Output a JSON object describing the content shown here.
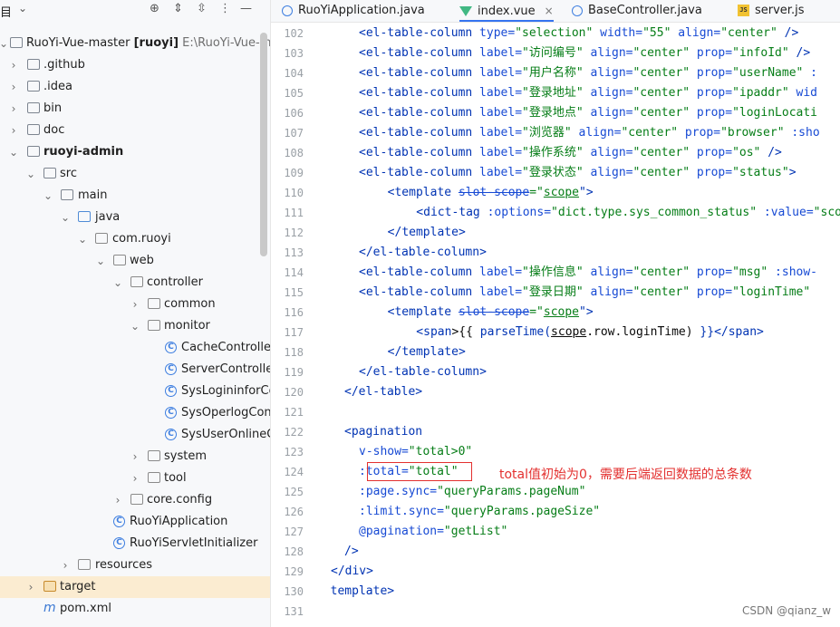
{
  "project_panel": {
    "title": "目",
    "tree": [
      {
        "label": "RuoYi-Vue-master",
        "bold_suffix": "[ruoyi]",
        "path": "E:\\RuoYi-Vue-m",
        "icon": "module-folder-icon"
      },
      {
        "label": ".github",
        "icon": "folder-icon"
      },
      {
        "label": ".idea",
        "icon": "folder-icon"
      },
      {
        "label": "bin",
        "icon": "folder-icon"
      },
      {
        "label": "doc",
        "icon": "folder-icon"
      },
      {
        "label": "ruoyi-admin",
        "icon": "module-folder-icon"
      },
      {
        "label": "src",
        "icon": "folder-icon"
      },
      {
        "label": "main",
        "icon": "folder-icon"
      },
      {
        "label": "java",
        "icon": "source-folder-icon"
      },
      {
        "label": "com.ruoyi",
        "icon": "package-icon"
      },
      {
        "label": "web",
        "icon": "package-icon"
      },
      {
        "label": "controller",
        "icon": "package-icon"
      },
      {
        "label": "common",
        "icon": "package-icon"
      },
      {
        "label": "monitor",
        "icon": "package-icon"
      },
      {
        "label": "CacheControlle",
        "icon": "class-icon"
      },
      {
        "label": "ServerControlle",
        "icon": "class-icon"
      },
      {
        "label": "SysLogininforCo",
        "icon": "class-icon"
      },
      {
        "label": "SysOperlogCon",
        "icon": "class-icon"
      },
      {
        "label": "SysUserOnlineC",
        "icon": "class-icon"
      },
      {
        "label": "system",
        "icon": "package-icon"
      },
      {
        "label": "tool",
        "icon": "package-icon"
      },
      {
        "label": "core.config",
        "icon": "package-icon"
      },
      {
        "label": "RuoYiApplication",
        "icon": "spring-class-icon"
      },
      {
        "label": "RuoYiServletInitializer",
        "icon": "class-icon"
      },
      {
        "label": "resources",
        "icon": "resources-folder-icon"
      },
      {
        "label": "target",
        "icon": "excluded-folder-icon"
      },
      {
        "label": "pom.xml",
        "icon": "maven-icon"
      }
    ]
  },
  "tabs": [
    {
      "label": "RuoYiApplication.java",
      "icon": "java-class-icon"
    },
    {
      "label": "index.vue",
      "icon": "vue-icon",
      "close": "×"
    },
    {
      "label": "BaseController.java",
      "icon": "java-class-icon"
    },
    {
      "label": "server.js",
      "icon": "js-icon",
      "icon_text": "JS"
    }
  ],
  "editor": {
    "line_numbers": [
      "102",
      "103",
      "104",
      "105",
      "106",
      "107",
      "108",
      "109",
      "110",
      "111",
      "112",
      "113",
      "114",
      "115",
      "116",
      "117",
      "118",
      "119",
      "120",
      "121",
      "122",
      "123",
      "124",
      "125",
      "126",
      "127",
      "128",
      "129",
      "130",
      "131"
    ],
    "lines": [
      [
        [
          "  <",
          "tag"
        ],
        [
          "el-table-column",
          "tag"
        ],
        [
          " type=",
          "attr"
        ],
        [
          "\"selection\"",
          "str"
        ],
        [
          " width=",
          "attr"
        ],
        [
          "\"55\"",
          "str"
        ],
        [
          " align=",
          "attr"
        ],
        [
          "\"center\"",
          "str"
        ],
        [
          " />",
          "tag"
        ]
      ],
      [
        [
          "  <",
          "tag"
        ],
        [
          "el-table-column",
          "tag"
        ],
        [
          " label=",
          "attr"
        ],
        [
          "\"访问编号\"",
          "str"
        ],
        [
          " align=",
          "attr"
        ],
        [
          "\"center\"",
          "str"
        ],
        [
          " prop=",
          "attr"
        ],
        [
          "\"infoId\"",
          "str"
        ],
        [
          " />",
          "tag"
        ]
      ],
      [
        [
          "  <",
          "tag"
        ],
        [
          "el-table-column",
          "tag"
        ],
        [
          " label=",
          "attr"
        ],
        [
          "\"用户名称\"",
          "str"
        ],
        [
          " align=",
          "attr"
        ],
        [
          "\"center\"",
          "str"
        ],
        [
          " prop=",
          "attr"
        ],
        [
          "\"userName\"",
          "str"
        ],
        [
          " :",
          "attr"
        ]
      ],
      [
        [
          "  <",
          "tag"
        ],
        [
          "el-table-column",
          "tag"
        ],
        [
          " label=",
          "attr"
        ],
        [
          "\"登录地址\"",
          "str"
        ],
        [
          " align=",
          "attr"
        ],
        [
          "\"center\"",
          "str"
        ],
        [
          " prop=",
          "attr"
        ],
        [
          "\"ipaddr\"",
          "str"
        ],
        [
          " wid",
          "attr"
        ]
      ],
      [
        [
          "  <",
          "tag"
        ],
        [
          "el-table-column",
          "tag"
        ],
        [
          " label=",
          "attr"
        ],
        [
          "\"登录地点\"",
          "str"
        ],
        [
          " align=",
          "attr"
        ],
        [
          "\"center\"",
          "str"
        ],
        [
          " prop=",
          "attr"
        ],
        [
          "\"loginLocati",
          "str"
        ]
      ],
      [
        [
          "  <",
          "tag"
        ],
        [
          "el-table-column",
          "tag"
        ],
        [
          " label=",
          "attr"
        ],
        [
          "\"浏览器\"",
          "str"
        ],
        [
          " align=",
          "attr"
        ],
        [
          "\"center\"",
          "str"
        ],
        [
          " prop=",
          "attr"
        ],
        [
          "\"browser\"",
          "str"
        ],
        [
          " :sho",
          "attr"
        ]
      ],
      [
        [
          "  <",
          "tag"
        ],
        [
          "el-table-column",
          "tag"
        ],
        [
          " label=",
          "attr"
        ],
        [
          "\"操作系统\"",
          "str"
        ],
        [
          " align=",
          "attr"
        ],
        [
          "\"center\"",
          "str"
        ],
        [
          " prop=",
          "attr"
        ],
        [
          "\"os\"",
          "str"
        ],
        [
          " />",
          "tag"
        ]
      ],
      [
        [
          "  <",
          "tag"
        ],
        [
          "el-table-column",
          "tag"
        ],
        [
          " label=",
          "attr"
        ],
        [
          "\"登录状态\"",
          "str"
        ],
        [
          " align=",
          "attr"
        ],
        [
          "\"center\"",
          "str"
        ],
        [
          " prop=",
          "attr"
        ],
        [
          "\"status\"",
          "str"
        ],
        [
          ">",
          "tag"
        ]
      ],
      [
        [
          "    <",
          "tag"
        ],
        [
          "template",
          "tag"
        ],
        [
          " ",
          ""
        ],
        [
          "slot-scope",
          "dep"
        ],
        [
          "=\"",
          "str"
        ],
        [
          "scope",
          "str ul"
        ],
        [
          "\">",
          "tag"
        ]
      ],
      [
        [
          "      <",
          "tag"
        ],
        [
          "dict-tag",
          "tag"
        ],
        [
          " :options=",
          "attr"
        ],
        [
          "\"dict.",
          "str"
        ],
        [
          "type",
          "str"
        ],
        [
          ".sys_common_status\"",
          "str"
        ],
        [
          " :value=",
          "attr"
        ],
        [
          "\"scop",
          "str"
        ]
      ],
      [
        [
          "    </",
          "tag"
        ],
        [
          "template",
          "tag"
        ],
        [
          ">",
          "tag"
        ]
      ],
      [
        [
          "  </",
          "tag"
        ],
        [
          "el-table-column",
          "tag"
        ],
        [
          ">",
          "tag"
        ]
      ],
      [
        [
          "  <",
          "tag"
        ],
        [
          "el-table-column",
          "tag"
        ],
        [
          " label=",
          "attr"
        ],
        [
          "\"操作信息\"",
          "str"
        ],
        [
          " align=",
          "attr"
        ],
        [
          "\"center\"",
          "str"
        ],
        [
          " prop=",
          "attr"
        ],
        [
          "\"msg\"",
          "str"
        ],
        [
          " :show-",
          "attr"
        ]
      ],
      [
        [
          "  <",
          "tag"
        ],
        [
          "el-table-column",
          "tag"
        ],
        [
          " label=",
          "attr"
        ],
        [
          "\"登录日期\"",
          "str"
        ],
        [
          " align=",
          "attr"
        ],
        [
          "\"center\"",
          "str"
        ],
        [
          " prop=",
          "attr"
        ],
        [
          "\"loginTime\"",
          "str"
        ]
      ],
      [
        [
          "    <",
          "tag"
        ],
        [
          "template",
          "tag"
        ],
        [
          " ",
          ""
        ],
        [
          "slot-scope",
          "dep"
        ],
        [
          "=\"",
          "str"
        ],
        [
          "scope",
          "str ul"
        ],
        [
          "\">",
          "tag"
        ]
      ],
      [
        [
          "      <",
          "tag"
        ],
        [
          "span",
          "tag"
        ],
        [
          ">{{ ",
          ""
        ],
        [
          "parseTime(",
          "tmpl"
        ],
        [
          "scope",
          "ul"
        ],
        [
          ".row.loginTime) ",
          ""
        ],
        [
          "}}</",
          "tag"
        ],
        [
          "span",
          "tag"
        ],
        [
          ">",
          "tag"
        ]
      ],
      [
        [
          "    </",
          "tag"
        ],
        [
          "template",
          "tag"
        ],
        [
          ">",
          "tag"
        ]
      ],
      [
        [
          "  </",
          "tag"
        ],
        [
          "el-table-column",
          "tag"
        ],
        [
          ">",
          "tag"
        ]
      ],
      [
        [
          "</",
          "tag"
        ],
        [
          "el-table",
          "tag"
        ],
        [
          ">",
          "tag"
        ]
      ],
      [
        [
          "",
          ""
        ]
      ],
      [
        [
          "<",
          "tag"
        ],
        [
          "pagination",
          "tag"
        ]
      ],
      [
        [
          "  v-show=",
          "attr"
        ],
        [
          "\"total>0\"",
          "str"
        ]
      ],
      [
        [
          "  :total=",
          "attr"
        ],
        [
          "\"total\"",
          "str"
        ]
      ],
      [
        [
          "  :page.sync=",
          "attr"
        ],
        [
          "\"queryParams.pageNum\"",
          "str"
        ]
      ],
      [
        [
          "  :limit.sync=",
          "attr"
        ],
        [
          "\"queryParams.pageSize\"",
          "str"
        ]
      ],
      [
        [
          "  @pagination=",
          "attr"
        ],
        [
          "\"getList\"",
          "str"
        ]
      ],
      [
        [
          "/>",
          "tag"
        ]
      ],
      [
        [
          "</",
          "tag"
        ],
        [
          "div",
          "tag"
        ],
        [
          ">",
          "tag"
        ]
      ],
      [
        [
          "</",
          "tag"
        ],
        [
          "template",
          "tag"
        ],
        [
          ">",
          "tag"
        ]
      ],
      [
        [
          "",
          ""
        ]
      ]
    ]
  },
  "annotation": {
    "text": "total值初始为0，需要后端返回数据的总条数",
    "color": "#e3302f"
  },
  "watermark": "CSDN @qianz_w"
}
